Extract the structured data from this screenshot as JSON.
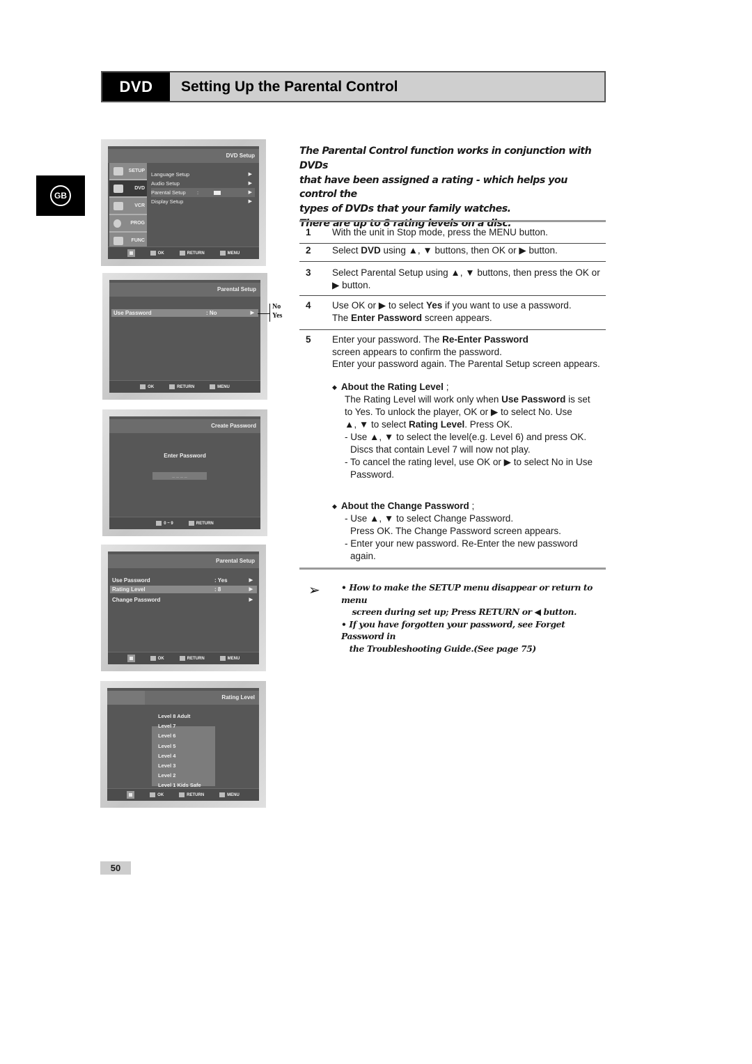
{
  "header": {
    "tag": "DVD",
    "title": "Setting Up the Parental Control"
  },
  "side_tab": "GB",
  "intro": [
    "The Parental Control function works in conjunction with DVDs",
    "that have been assigned a rating - which helps you control the",
    "types of DVDs that your family watches.",
    "There are up to 8 rating levels on a disc."
  ],
  "steps": [
    {
      "num": "1",
      "text": "With the unit in Stop mode, press the MENU button."
    },
    {
      "num": "2",
      "pre": "Select ",
      "bold": "DVD",
      "post": " using ▲, ▼ buttons, then OK or ▶ button."
    },
    {
      "num": "3",
      "text": "Select Parental Setup using ▲, ▼ buttons, then press the OK or ▶ button."
    },
    {
      "num": "4",
      "pre": "Use OK or ▶ to select ",
      "bold": "Yes",
      "post": " if you want to use a password.",
      "line2_pre": "The ",
      "line2_bold": "Enter Password",
      "line2_post": " screen appears."
    },
    {
      "num": "5",
      "pre": "Enter your password. The ",
      "bold": "Re-Enter Password",
      "post": "",
      "line2": "screen appears to confirm the password.",
      "line3": "Enter your password again. The Parental Setup screen appears."
    }
  ],
  "rating_section": {
    "heading": "About the Rating Level",
    "suffix": " ;",
    "l1_pre": "The Rating Level will work only when ",
    "l1_bold": "Use Password",
    "l1_post": " is set",
    "l2": " to Yes. To unlock the player, OK or ▶ to select No. Use",
    "l3_pre": "▲, ▼ to select ",
    "l3_bold": "Rating Level",
    "l3_post": ". Press OK.",
    "l4": "- Use ▲, ▼ to select the level(e.g. Level 6) and press OK.",
    "l5": "  Discs that contain Level 7 will now not play.",
    "l6": "- To cancel the rating level, use OK or ▶ to select No in Use",
    "l7": "  Password."
  },
  "change_section": {
    "heading": "About the Change Password",
    "suffix": " ;",
    "l1": "- Use ▲, ▼ to select Change Password.",
    "l2": "  Press OK. The Change Password screen appears.",
    "l3": "- Enter your new password. Re-Enter the new password",
    "l4": "  again."
  },
  "notes": [
    "•  How to make the SETUP menu disappear or return to menu",
    "    screen during set up; Press RETURN or ◀ button.",
    "• If you have forgotten your password, see Forget Password in",
    "   the Troubleshooting Guide.(See page 75)"
  ],
  "page_number": "50",
  "osd_footer": {
    "ok": "OK",
    "return": "RETURN",
    "menu": "MENU",
    "digits": "0 ~ 9"
  },
  "screen1": {
    "title": "DVD Setup",
    "side": [
      "SETUP",
      "DVD",
      "VCR",
      "PROG",
      "FUNC"
    ],
    "items": [
      "Language Setup",
      "Audio Setup",
      "Parental Setup",
      "Display Setup"
    ],
    "arrow": "▶",
    "colon": ":"
  },
  "screen2": {
    "title": "Parental Setup",
    "row_label": "Use Password",
    "row_value": ": No",
    "callout": [
      "No",
      "Yes"
    ]
  },
  "screen3": {
    "title": "Create Password",
    "prompt": "Enter Password",
    "field": "_ _ _ _"
  },
  "screen4": {
    "title": "Parental Setup",
    "rows": [
      {
        "label": "Use Password",
        "value": ":   Yes"
      },
      {
        "label": "Rating Level",
        "value": ":    8"
      },
      {
        "label": "Change Password",
        "value": ""
      }
    ]
  },
  "screen5": {
    "title": "Rating Level",
    "levels": [
      "Level  8  Adult",
      "Level  7",
      "Level  6",
      "Level  5",
      "Level  4",
      "Level  3",
      "Level  2",
      "Level  1 Kids Safe"
    ]
  }
}
